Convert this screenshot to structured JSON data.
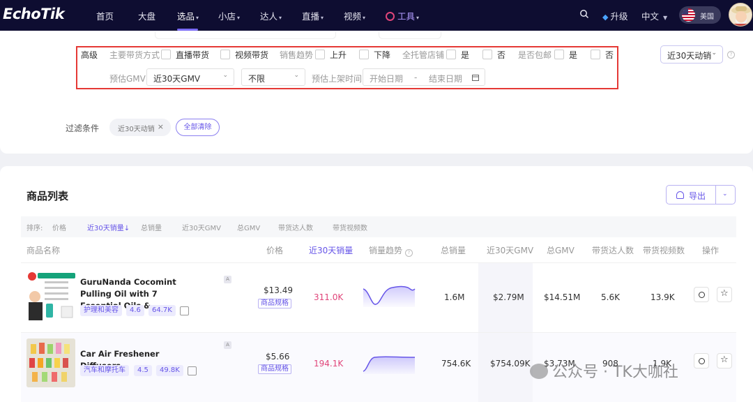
{
  "nav": {
    "logo": "EchoTik",
    "items": [
      "首页",
      "大盘",
      "选品",
      "小店",
      "达人",
      "直播",
      "视频",
      "工具"
    ],
    "active_index": 2,
    "upgrade": "升级",
    "language": "中文",
    "region": "美国"
  },
  "filters": {
    "advanced_label": "高级",
    "sales_method_label": "主要带货方式",
    "sales_method_options": [
      "直播带货",
      "视频带货"
    ],
    "sales_trend_label": "销售趋势",
    "sales_trend_options": [
      "上升",
      "下降"
    ],
    "managed_store_label": "全托管店铺",
    "managed_store_options": [
      "是",
      "否"
    ],
    "free_shipping_label": "是否包邮",
    "free_shipping_options": [
      "是",
      "否"
    ],
    "gmv_label": "预估GMV",
    "gmv_period": "近30天GMV",
    "gmv_range": "不限",
    "listing_time_label": "预估上架时间",
    "start_date_placeholder": "开始日期",
    "date_separator": "-",
    "end_date_placeholder": "结束日期",
    "sort_select": "近30天动销",
    "conditions_label": "过滤条件",
    "condition_tag": "近30天动销",
    "clear_all": "全部清除"
  },
  "list": {
    "title": "商品列表",
    "export_label": "导出",
    "sort_label": "排序:",
    "sort_options": [
      "价格",
      "近30天销量↓",
      "总销量",
      "近30天GMV",
      "总GMV",
      "带货达人数",
      "带货视频数"
    ],
    "columns": [
      "商品名称",
      "价格",
      "近30天销量",
      "销量趋势",
      "总销量",
      "近30天GMV",
      "总GMV",
      "带货达人数",
      "带货视频数",
      "操作"
    ],
    "products": [
      {
        "name": "GuruNanda Cocomint Pulling Oil with 7 Essential Oils &...",
        "category": "护理和美容",
        "rating": "4.6",
        "reviews": "64.7K",
        "price": "$13.49",
        "spec": "商品规格",
        "sales_30d": "311.0K",
        "total_sales": "1.6M",
        "gmv_30d": "$2.79M",
        "total_gmv": "$14.51M",
        "creators": "5.6K",
        "videos": "13.9K"
      },
      {
        "name": "Car Air Freshener Diffusers",
        "category": "汽车和摩托车",
        "rating": "4.5",
        "reviews": "49.8K",
        "price": "$5.66",
        "spec": "商品规格",
        "sales_30d": "194.1K",
        "total_sales": "754.6K",
        "gmv_30d": "$754.09K",
        "total_gmv": "$3.73M",
        "creators": "908",
        "videos": "1.9K"
      }
    ]
  },
  "watermark": "公众号 · TK大咖社",
  "colors": {
    "nav_bg": "#0e0d31",
    "accent": "#6655e8",
    "highlight_border": "#e53935",
    "sales_pink": "#e0457a"
  }
}
